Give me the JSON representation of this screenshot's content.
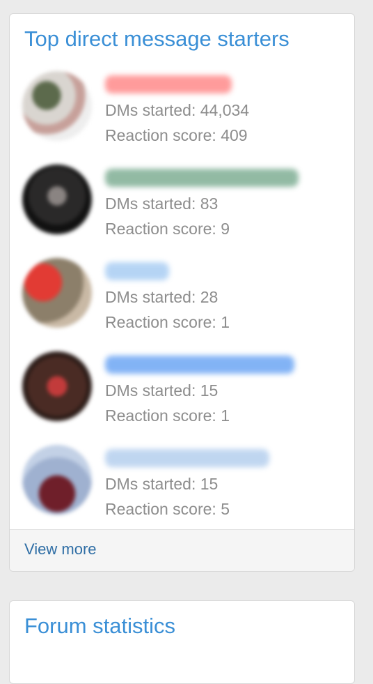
{
  "top_widget": {
    "title": "Top direct message starters",
    "members": [
      {
        "dms_started": "DMs started: 44,034",
        "reaction_score": "Reaction score: 409",
        "avatar_color": "#b9b0a8",
        "name_color": "#ff8a8a"
      },
      {
        "dms_started": "DMs started: 83",
        "reaction_score": "Reaction score: 9",
        "avatar_color": "#3a3838",
        "name_color": "#7fae94"
      },
      {
        "dms_started": "DMs started: 28",
        "reaction_score": "Reaction score: 1",
        "avatar_color": "#b85650",
        "name_color": "#a9cdf3"
      },
      {
        "dms_started": "DMs started: 15",
        "reaction_score": "Reaction score: 1",
        "avatar_color": "#6a3f32",
        "name_color": "#6da6f4"
      },
      {
        "dms_started": "DMs started: 15",
        "reaction_score": "Reaction score: 5",
        "avatar_color": "#a9b8d3",
        "name_color": "#b5cfee"
      }
    ],
    "view_more": "View more"
  },
  "stats_widget": {
    "title": "Forum statistics"
  },
  "colors": {
    "title": "#3a8fd6",
    "link": "#2f6ea5",
    "muted_text": "#8d8d8d",
    "background": "#ebebeb"
  }
}
